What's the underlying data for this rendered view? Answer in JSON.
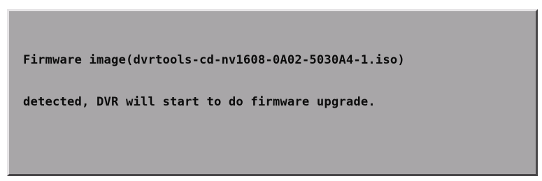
{
  "dialog": {
    "lines": [
      "Firmware image(dvrtools-cd-nv1608-0A02-5030A4-1.iso)",
      "detected, DVR will start to do firmware upgrade."
    ]
  },
  "colors": {
    "dialog_background": "#a8a6a8",
    "text": "#0c0c0c",
    "page_background": "#ffffff"
  }
}
